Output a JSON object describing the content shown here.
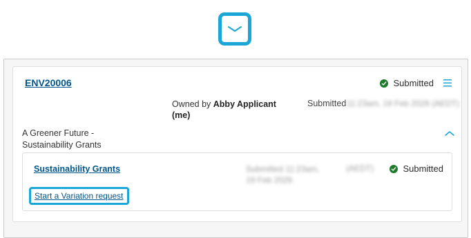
{
  "toggle": {
    "icon": "chevron-down-icon"
  },
  "application": {
    "reference": "ENV20006",
    "status": "Submitted",
    "owned_by_prefix": "Owned by",
    "owner_name": "Abby Applicant",
    "owner_suffix": "(me)",
    "submitted_label": "Submitted",
    "submitted_date_redacted": "11:23am, 19 Feb 2026 (AEDT)",
    "program_title": "A Greener Future - Sustainability Grants"
  },
  "submission": {
    "grant_name": "Sustainability Grants",
    "submitted_text_redacted": "Submitted 11:23am, 19 Feb 2026",
    "timezone_redacted": "(AEDT)",
    "status": "Submitted",
    "variation_link": "Start a Variation request"
  },
  "colors": {
    "link": "#00558a",
    "focus_ring": "#1aa6d6",
    "success": "#1d7a2c"
  }
}
